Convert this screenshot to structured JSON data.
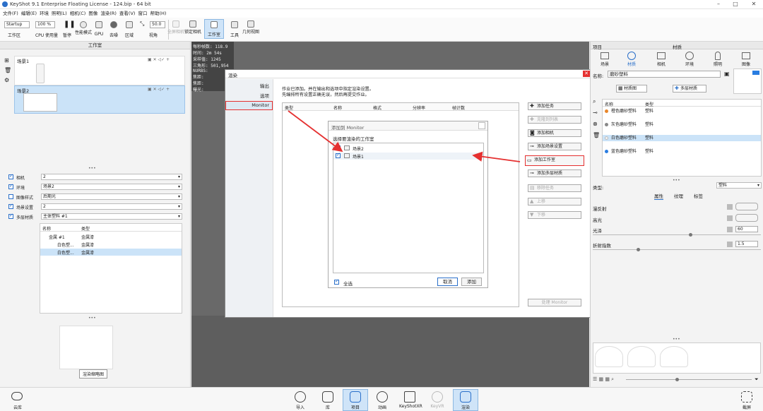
{
  "app": {
    "title": "KeyShot 9.1 Enterprise Floating License - 124.bip - 64 bit"
  },
  "menu": [
    "文件(F)",
    "编辑(E)",
    "环境",
    "照明(L)",
    "相机(C)",
    "图像",
    "渲染(R)",
    "查看(V)",
    "窗口",
    "帮助(H)"
  ],
  "toolbar": {
    "workspace_value": "Startup",
    "cpu_value": "100 %",
    "zoom_value": "50.0",
    "labels": [
      "工作区",
      "CPU 使用量",
      "暂停",
      "性能模式",
      "GPU",
      "去噪",
      "区域",
      "视角",
      "全屏相机",
      "锁定相机",
      "工作室",
      "工具",
      "几何视图"
    ]
  },
  "left": {
    "title": "工作室",
    "studios": [
      {
        "name": "场景1"
      },
      {
        "name": "场景2"
      }
    ],
    "props": [
      {
        "label": "相机",
        "value": "2",
        "checked": true
      },
      {
        "label": "环境",
        "value": "场景2",
        "checked": true
      },
      {
        "label": "图像样式",
        "value": "后期光",
        "checked": false
      },
      {
        "label": "场景设置",
        "value": "2",
        "checked": true
      },
      {
        "label": "多层材质",
        "value": "主体塑料 #1",
        "checked": true
      }
    ],
    "tree_headers": [
      "名称",
      "类型"
    ],
    "tree": [
      {
        "name": "金属 #1",
        "type": "金属漆"
      },
      {
        "name": "白色塑...",
        "type": "金属漆"
      },
      {
        "name": "白色塑...",
        "type": "金属漆"
      }
    ],
    "thumb_caption": "渲染缩略图"
  },
  "hud": {
    "rows": [
      [
        "每秒帧数:",
        "118.9"
      ],
      [
        "时间:",
        "2m 54s"
      ],
      [
        "采样值:",
        "1245"
      ],
      [
        "三角形:",
        "501,954"
      ],
      [
        "NURBS:",
        ""
      ],
      [
        "焦距:",
        ""
      ],
      [
        "焦距:",
        ""
      ],
      [
        "曝光:",
        ""
      ]
    ]
  },
  "render_dialog": {
    "title": "渲染",
    "nav": [
      "输出",
      "选项",
      "Monitor"
    ],
    "info": "作业已添加。并在输出和选项中指定渲染设置。\n先编排所有设置正确无误，然后再提交作业。",
    "columns": [
      "类型",
      "名称",
      "格式",
      "分辨率",
      "帧计数"
    ],
    "buttons": [
      {
        "label": "添加任务",
        "disabled": false
      },
      {
        "label": "克隆到列表",
        "disabled": true
      },
      {
        "label": "添加相机",
        "disabled": false
      },
      {
        "label": "添加场景设置",
        "disabled": false
      },
      {
        "label": "添加工作室",
        "disabled": false
      },
      {
        "label": "添加多层材质",
        "disabled": false
      },
      {
        "label": "移除任务",
        "disabled": true
      },
      {
        "label": "上移",
        "disabled": true
      },
      {
        "label": "下移",
        "disabled": true
      }
    ],
    "process_label": "处理 Monitor"
  },
  "add_dialog": {
    "title": "添加到 Monitor",
    "prompt": "选择要渲染的工作室",
    "items": [
      {
        "name": "场景2",
        "checked": true
      },
      {
        "name": "场景1",
        "checked": true
      }
    ],
    "select_all": "全选",
    "cancel": "取消",
    "add": "添加"
  },
  "right": {
    "tabs": [
      "项目",
      "材质"
    ],
    "icons": [
      "场景",
      "材质",
      "相机",
      "环境",
      "照明",
      "图像"
    ],
    "name_label": "名称:",
    "name_value": "磨砂塑料",
    "graph_btn": "材质图",
    "multi_btn": "多层材质",
    "list_headers": [
      "名称",
      "类型"
    ],
    "materials": [
      {
        "name": "橙色磨砂塑料",
        "type": "塑料",
        "color": "#e8862a"
      },
      {
        "name": "灰色磨砂塑料",
        "type": "塑料",
        "color": "#888888"
      },
      {
        "name": "白色磨砂塑料",
        "type": "塑料",
        "color": "#f4f4f4"
      },
      {
        "name": "蓝色磨砂塑料",
        "type": "塑料",
        "color": "#2a7de1"
      }
    ],
    "type_label": "类型:",
    "type_value": "塑料",
    "prop_tabs": [
      "属性",
      "纹理",
      "标签"
    ],
    "props": [
      {
        "label": "漫反射"
      },
      {
        "label": "高光"
      },
      {
        "label": "光泽",
        "value": "60"
      },
      {
        "label": "折射指数",
        "value": "1.5"
      }
    ]
  },
  "bottom": {
    "cloud": "云库",
    "items": [
      "导入",
      "库",
      "项目",
      "动画",
      "KeyShotXR",
      "KeyVR",
      "渲染"
    ],
    "right": "截屏"
  }
}
